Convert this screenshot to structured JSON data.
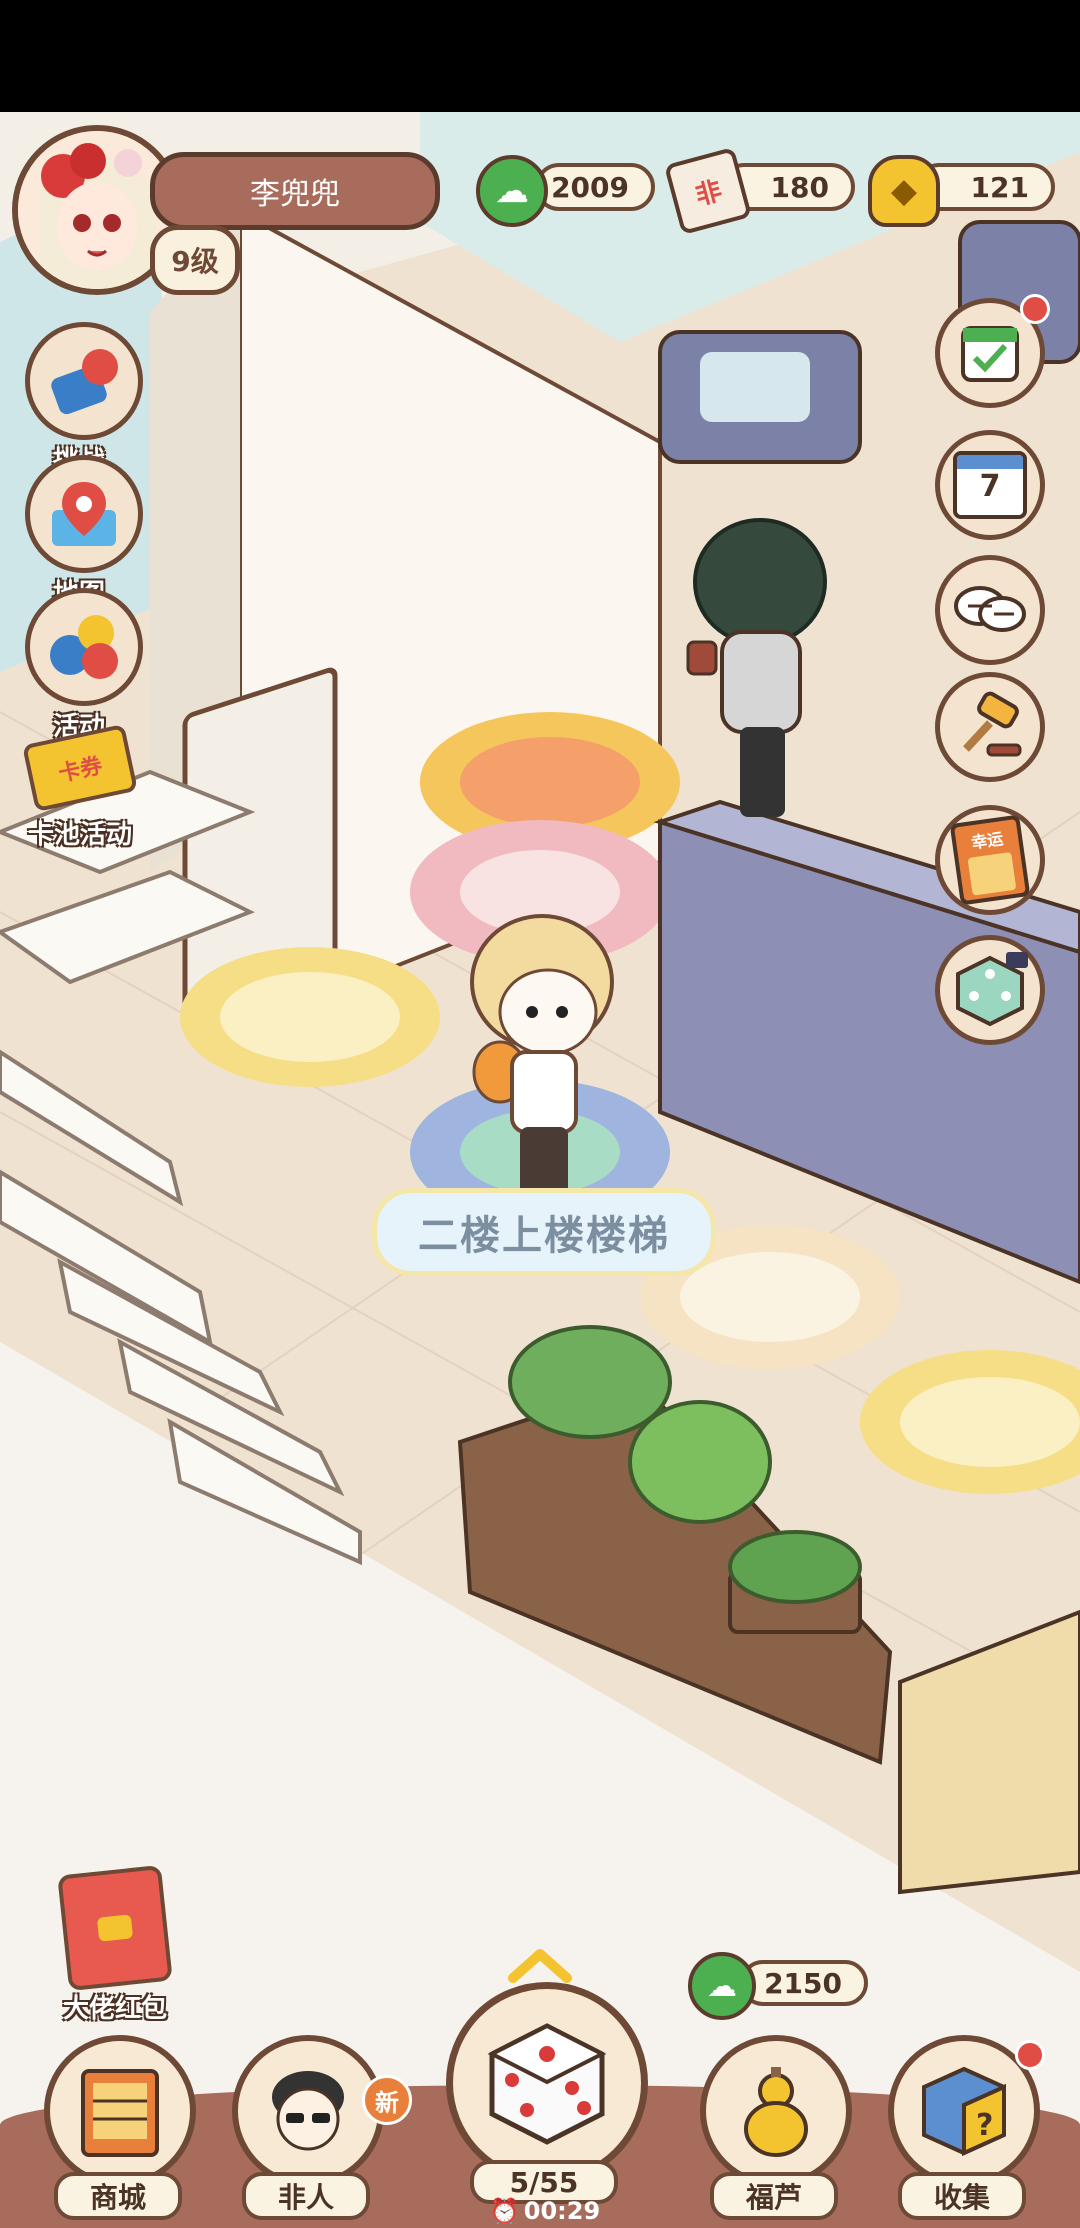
{
  "player": {
    "name": "李兜兜",
    "level": "9级"
  },
  "currencies": {
    "jade": "2009",
    "ticket": "180",
    "gold": "121",
    "ticket_icon_text": "非"
  },
  "left_menu": [
    {
      "label": "挑战",
      "icon": "challenge-icon"
    },
    {
      "label": "地图",
      "icon": "map-pin-icon"
    },
    {
      "label": "活动",
      "icon": "balloons-icon"
    },
    {
      "label": "卡池活动",
      "icon": "card-ticket-icon",
      "badge": "卡券"
    }
  ],
  "right_menu": [
    {
      "icon": "checklist-calendar-icon",
      "red_dot": true
    },
    {
      "icon": "calendar-icon",
      "text": "7"
    },
    {
      "icon": "chat-bubbles-icon"
    },
    {
      "icon": "gavel-icon"
    },
    {
      "icon": "lucky-scratch-card-icon",
      "text": "幸运"
    },
    {
      "icon": "dice-tv-icon"
    }
  ],
  "scene": {
    "location_label": "二楼上楼楼梯"
  },
  "red_packet": {
    "label": "大佬红包"
  },
  "dice": {
    "count": "5/55",
    "timer": "00:29",
    "reward": "2150"
  },
  "bottom_nav": {
    "shop": "商城",
    "npc": "非人",
    "npc_badge": "新",
    "gourd": "福芦",
    "collection": "收集"
  },
  "colors": {
    "accent": "#a86c5c",
    "outline": "#6e4a36",
    "jade": "#4caf50",
    "gold": "#f4c430",
    "red": "#e04d45"
  }
}
